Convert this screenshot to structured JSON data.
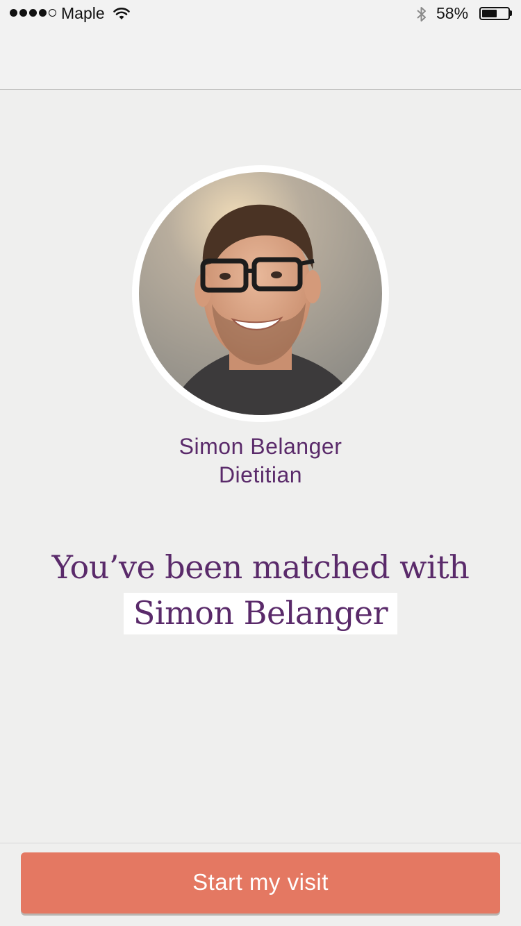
{
  "status_bar": {
    "signal_dots_filled": 4,
    "signal_dots_total": 5,
    "carrier": "Maple",
    "wifi_icon": "wifi-icon",
    "bluetooth_icon": "bluetooth-icon",
    "battery_percent": "58%",
    "battery_level": 0.58
  },
  "provider": {
    "name": "Simon Belanger",
    "role": "Dietitian",
    "avatar_icon": "provider-photo"
  },
  "match": {
    "headline": "You’ve been matched with",
    "highlight_name": "Simon Belanger"
  },
  "actions": {
    "start_label": "Start my visit"
  },
  "colors": {
    "accent_purple": "#5a2a6a",
    "button_coral": "#e47862",
    "background": "#efefee"
  }
}
